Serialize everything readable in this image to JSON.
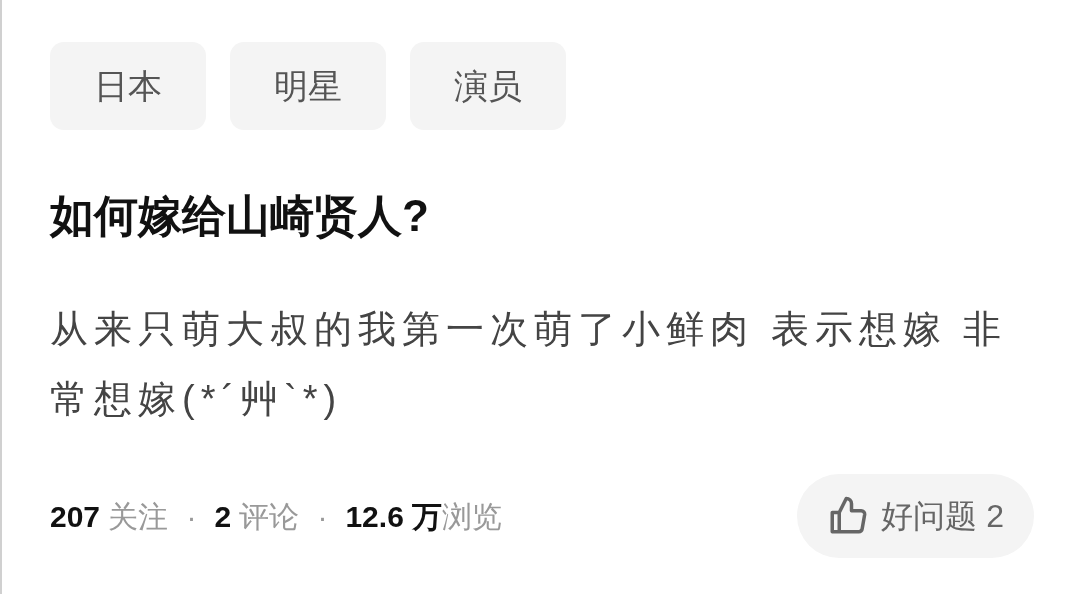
{
  "tags": [
    "日本",
    "明星",
    "演员"
  ],
  "title": "如何嫁给山崎贤人?",
  "description": "从来只萌大叔的我第一次萌了小鲜肉 表示想嫁 非常想嫁(*´艸`*)",
  "stats": [
    {
      "text": "**207** 关注",
      "separator": "·"
    },
    {
      "text": "**2** 评论",
      "separator": "·"
    },
    {
      "text": "**12.6 万**浏览"
    }
  ],
  "good_question_button": {
    "label": "好问题 2"
  }
}
